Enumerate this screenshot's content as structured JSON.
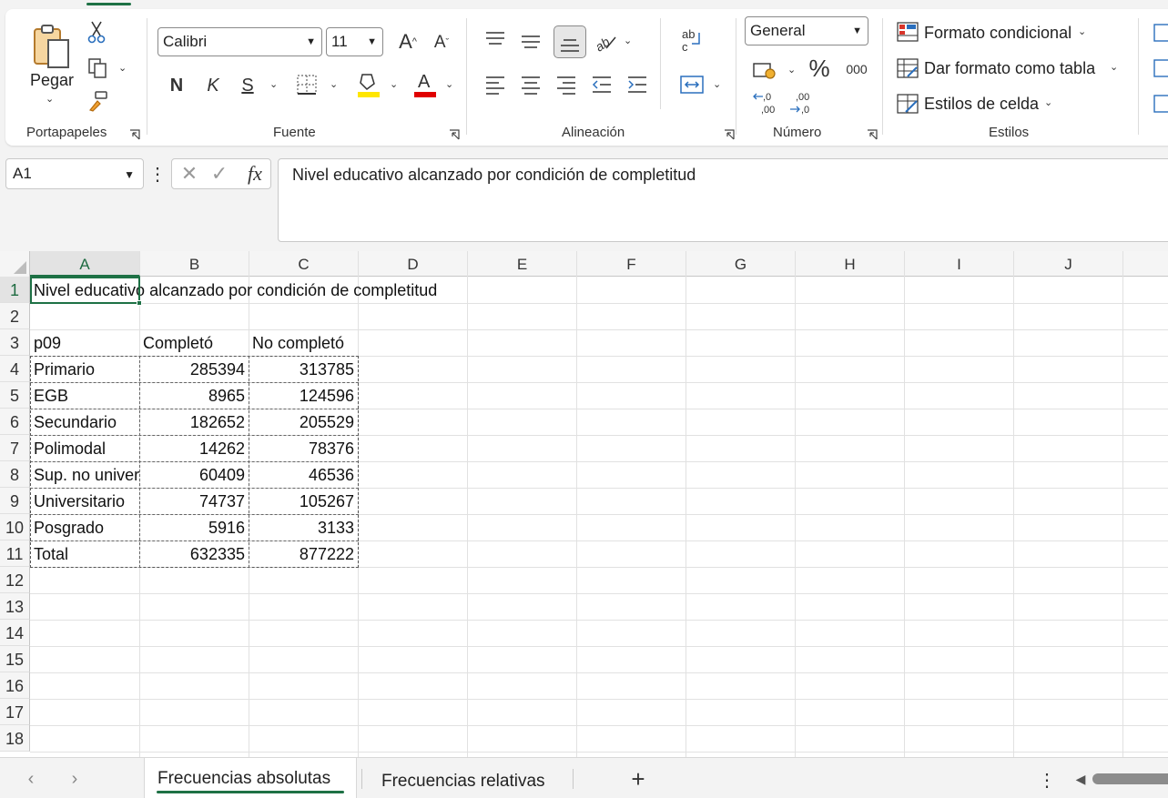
{
  "ribbon": {
    "clipboard": {
      "paste_label": "Pegar",
      "group_label": "Portapapeles"
    },
    "font": {
      "font_name": "Calibri",
      "font_size": "11",
      "bold": "N",
      "italic": "K",
      "underline": "S",
      "group_label": "Fuente",
      "highlight_color": "#ffe600",
      "font_color": "#e00000"
    },
    "alignment": {
      "group_label": "Alineación"
    },
    "number": {
      "format": "General",
      "percent": "%",
      "thousands": "000",
      "group_label": "Número"
    },
    "styles": {
      "conditional": "Formato condicional",
      "as_table": "Dar formato como tabla",
      "cell_styles": "Estilos de celda",
      "group_label": "Estilos"
    }
  },
  "formula_bar": {
    "name_box": "A1",
    "fx": "fx",
    "content": "Nivel educativo alcanzado por condición de completitud"
  },
  "columns": [
    "A",
    "B",
    "C",
    "D",
    "E",
    "F",
    "G",
    "H",
    "I",
    "J"
  ],
  "rows": [
    "1",
    "2",
    "3",
    "4",
    "5",
    "6",
    "7",
    "8",
    "9",
    "10",
    "11",
    "12",
    "13",
    "14",
    "15",
    "16",
    "17",
    "18"
  ],
  "sheet": {
    "title": "Nivel educativo alcanzado por condición de completitud",
    "headers": [
      "p09",
      "Completó",
      "No completó"
    ],
    "data": [
      [
        "Primario",
        "285394",
        "313785"
      ],
      [
        "EGB",
        "8965",
        "124596"
      ],
      [
        "Secundario",
        "182652",
        "205529"
      ],
      [
        "Polimodal",
        "14262",
        "78376"
      ],
      [
        "Sup. no universitario",
        "60409",
        "46536"
      ],
      [
        "Universitario",
        "74737",
        "105267"
      ],
      [
        "Posgrado",
        "5916",
        "3133"
      ],
      [
        "Total",
        "632335",
        "877222"
      ]
    ]
  },
  "tabs": {
    "active": "Frecuencias absolutas",
    "other": "Frecuencias relativas",
    "add": "+"
  },
  "colors": {
    "accent": "#1e7145"
  }
}
